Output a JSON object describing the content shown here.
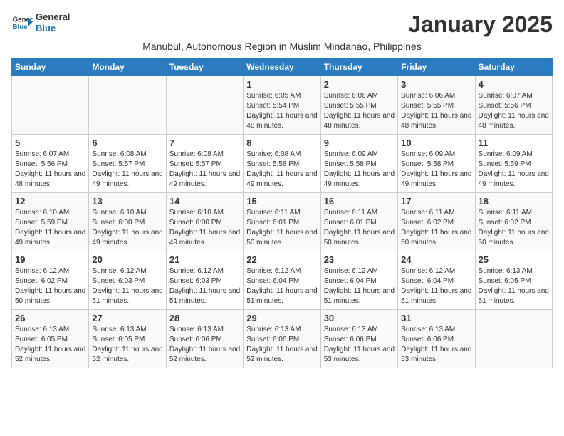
{
  "logo": {
    "line1": "General",
    "line2": "Blue"
  },
  "title": "January 2025",
  "subtitle": "Manubul, Autonomous Region in Muslim Mindanao, Philippines",
  "weekdays": [
    "Sunday",
    "Monday",
    "Tuesday",
    "Wednesday",
    "Thursday",
    "Friday",
    "Saturday"
  ],
  "weeks": [
    [
      {
        "day": "",
        "info": ""
      },
      {
        "day": "",
        "info": ""
      },
      {
        "day": "",
        "info": ""
      },
      {
        "day": "1",
        "sunrise": "6:05 AM",
        "sunset": "5:54 PM",
        "daylight": "11 hours and 48 minutes."
      },
      {
        "day": "2",
        "sunrise": "6:06 AM",
        "sunset": "5:55 PM",
        "daylight": "11 hours and 48 minutes."
      },
      {
        "day": "3",
        "sunrise": "6:06 AM",
        "sunset": "5:55 PM",
        "daylight": "11 hours and 48 minutes."
      },
      {
        "day": "4",
        "sunrise": "6:07 AM",
        "sunset": "5:56 PM",
        "daylight": "11 hours and 48 minutes."
      }
    ],
    [
      {
        "day": "5",
        "sunrise": "6:07 AM",
        "sunset": "5:56 PM",
        "daylight": "11 hours and 48 minutes."
      },
      {
        "day": "6",
        "sunrise": "6:08 AM",
        "sunset": "5:57 PM",
        "daylight": "11 hours and 49 minutes."
      },
      {
        "day": "7",
        "sunrise": "6:08 AM",
        "sunset": "5:57 PM",
        "daylight": "11 hours and 49 minutes."
      },
      {
        "day": "8",
        "sunrise": "6:08 AM",
        "sunset": "5:58 PM",
        "daylight": "11 hours and 49 minutes."
      },
      {
        "day": "9",
        "sunrise": "6:09 AM",
        "sunset": "5:58 PM",
        "daylight": "11 hours and 49 minutes."
      },
      {
        "day": "10",
        "sunrise": "6:09 AM",
        "sunset": "5:58 PM",
        "daylight": "11 hours and 49 minutes."
      },
      {
        "day": "11",
        "sunrise": "6:09 AM",
        "sunset": "5:59 PM",
        "daylight": "11 hours and 49 minutes."
      }
    ],
    [
      {
        "day": "12",
        "sunrise": "6:10 AM",
        "sunset": "5:59 PM",
        "daylight": "11 hours and 49 minutes."
      },
      {
        "day": "13",
        "sunrise": "6:10 AM",
        "sunset": "6:00 PM",
        "daylight": "11 hours and 49 minutes."
      },
      {
        "day": "14",
        "sunrise": "6:10 AM",
        "sunset": "6:00 PM",
        "daylight": "11 hours and 49 minutes."
      },
      {
        "day": "15",
        "sunrise": "6:11 AM",
        "sunset": "6:01 PM",
        "daylight": "11 hours and 50 minutes."
      },
      {
        "day": "16",
        "sunrise": "6:11 AM",
        "sunset": "6:01 PM",
        "daylight": "11 hours and 50 minutes."
      },
      {
        "day": "17",
        "sunrise": "6:11 AM",
        "sunset": "6:02 PM",
        "daylight": "11 hours and 50 minutes."
      },
      {
        "day": "18",
        "sunrise": "6:11 AM",
        "sunset": "6:02 PM",
        "daylight": "11 hours and 50 minutes."
      }
    ],
    [
      {
        "day": "19",
        "sunrise": "6:12 AM",
        "sunset": "6:02 PM",
        "daylight": "11 hours and 50 minutes."
      },
      {
        "day": "20",
        "sunrise": "6:12 AM",
        "sunset": "6:03 PM",
        "daylight": "11 hours and 51 minutes."
      },
      {
        "day": "21",
        "sunrise": "6:12 AM",
        "sunset": "6:03 PM",
        "daylight": "11 hours and 51 minutes."
      },
      {
        "day": "22",
        "sunrise": "6:12 AM",
        "sunset": "6:04 PM",
        "daylight": "11 hours and 51 minutes."
      },
      {
        "day": "23",
        "sunrise": "6:12 AM",
        "sunset": "6:04 PM",
        "daylight": "11 hours and 51 minutes."
      },
      {
        "day": "24",
        "sunrise": "6:12 AM",
        "sunset": "6:04 PM",
        "daylight": "11 hours and 51 minutes."
      },
      {
        "day": "25",
        "sunrise": "6:13 AM",
        "sunset": "6:05 PM",
        "daylight": "11 hours and 51 minutes."
      }
    ],
    [
      {
        "day": "26",
        "sunrise": "6:13 AM",
        "sunset": "6:05 PM",
        "daylight": "11 hours and 52 minutes."
      },
      {
        "day": "27",
        "sunrise": "6:13 AM",
        "sunset": "6:05 PM",
        "daylight": "11 hours and 52 minutes."
      },
      {
        "day": "28",
        "sunrise": "6:13 AM",
        "sunset": "6:06 PM",
        "daylight": "11 hours and 52 minutes."
      },
      {
        "day": "29",
        "sunrise": "6:13 AM",
        "sunset": "6:06 PM",
        "daylight": "11 hours and 52 minutes."
      },
      {
        "day": "30",
        "sunrise": "6:13 AM",
        "sunset": "6:06 PM",
        "daylight": "11 hours and 53 minutes."
      },
      {
        "day": "31",
        "sunrise": "6:13 AM",
        "sunset": "6:06 PM",
        "daylight": "11 hours and 53 minutes."
      },
      {
        "day": "",
        "info": ""
      }
    ]
  ],
  "labels": {
    "sunrise": "Sunrise:",
    "sunset": "Sunset:",
    "daylight": "Daylight:"
  }
}
